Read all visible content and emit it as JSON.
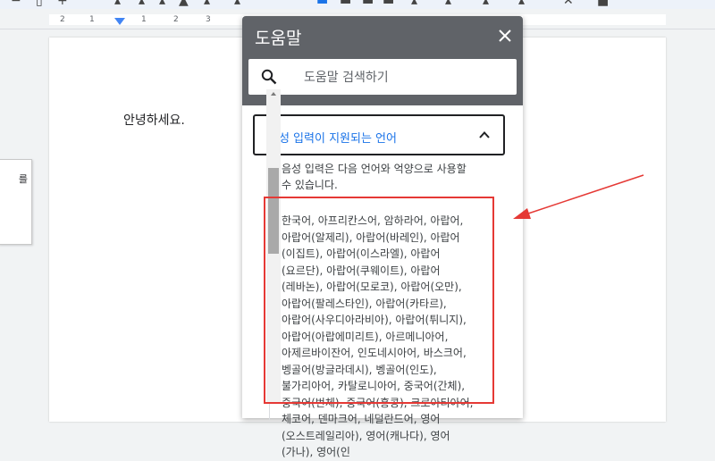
{
  "document": {
    "body_text": "안녕하세요.",
    "side_panel_text": "를"
  },
  "ruler": {
    "numbers": [
      "2",
      "1",
      "1",
      "2",
      "3"
    ]
  },
  "help_panel": {
    "title": "도움말",
    "search_placeholder": "도움말 검색하기",
    "section_title": "음성 입력이 지원되는 언어",
    "intro_text": "음성 입력은 다음 언어와 억양으로 사용할 수 있습니다.",
    "languages_text": "한국어, 아프리칸스어, 암하라어, 아랍어, 아랍어(알제리), 아랍어(바레인), 아랍어(이집트), 아랍어(이스라엘), 아랍어(요르단), 아랍어(쿠웨이트), 아랍어(레바논), 아랍어(모로코), 아랍어(오만), 아랍어(팔레스타인), 아랍어(카타르), 아랍어(사우디아라비아), 아랍어(튀니지), 아랍어(아랍에미리트), 아르메니아어, 아제르바이잔어, 인도네시아어, 바스크어, 벵골어(방글라데시), 벵골어(인도), 불가리아어, 카탈로니아어, 중국어(간체), 중국어(번체), 중국어(홍콩), 크로아티아어, 체코어, 덴마크어, 네덜란드어, 영어(오스트레일리아), 영어(캐나다), 영어(가나), 영어(인"
  },
  "colors": {
    "header_bg": "#606368",
    "link_blue": "#1a73e8",
    "highlight_red": "#e53935"
  },
  "icons": {
    "close": "close-icon",
    "search": "search-icon",
    "chevron": "chevron-up-icon",
    "arrow": "annotation-arrow"
  }
}
